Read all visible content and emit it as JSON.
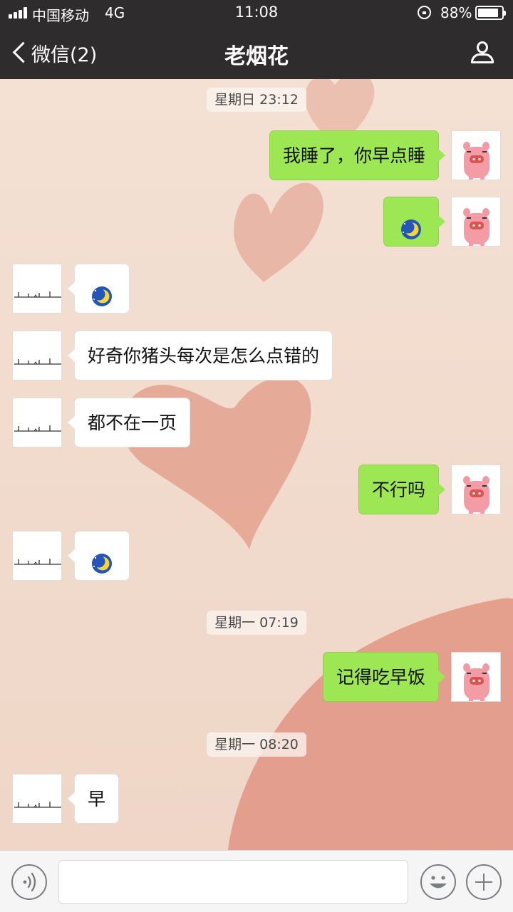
{
  "status_bar": {
    "carrier": "中国移动",
    "network": "4G",
    "time": "11:08",
    "battery": "88%",
    "battery_level": 0.88,
    "icons": [
      "signal-icon",
      "orientation-lock-icon",
      "battery-icon"
    ]
  },
  "nav": {
    "back_label": "微信(2)",
    "title": "老烟花",
    "back_icon": "chevron-left-icon",
    "profile_icon": "person-icon"
  },
  "timestamps": [
    "星期日 23:12",
    "星期一 07:19",
    "星期一 08:20"
  ],
  "messages": [
    {
      "side": "out",
      "type": "text",
      "text": "我睡了，你早点睡",
      "avatar": "pink-pig-avatar"
    },
    {
      "side": "out",
      "type": "sticker",
      "sticker": "sleeping-moon-emoji",
      "avatar": "pink-pig-avatar"
    },
    {
      "side": "in",
      "type": "sticker",
      "sticker": "sleeping-moon-emoji",
      "avatar": "line-sketch-avatar"
    },
    {
      "side": "in",
      "type": "text",
      "text": "好奇你猪头每次是怎么点错的",
      "avatar": "line-sketch-avatar"
    },
    {
      "side": "in",
      "type": "text",
      "text": "都不在一页",
      "avatar": "line-sketch-avatar"
    },
    {
      "side": "out",
      "type": "text",
      "text": "不行吗",
      "avatar": "pink-pig-avatar"
    },
    {
      "side": "in",
      "type": "sticker",
      "sticker": "sleeping-moon-emoji",
      "avatar": "line-sketch-avatar"
    },
    {
      "side": "out",
      "type": "text",
      "text": "记得吃早饭",
      "avatar": "pink-pig-avatar"
    },
    {
      "side": "in",
      "type": "text",
      "text": "早",
      "avatar": "line-sketch-avatar"
    }
  ],
  "input_bar": {
    "message_value": "",
    "icons": [
      "voice-icon",
      "emoji-icon",
      "plus-icon"
    ]
  },
  "colors": {
    "header": "#2e2c2d",
    "outgoing_bubble": "#9ee754",
    "incoming_bubble": "#ffffff",
    "wallpaper": "#f3ddd0",
    "wallpaper_hearts": "#e5a090"
  }
}
